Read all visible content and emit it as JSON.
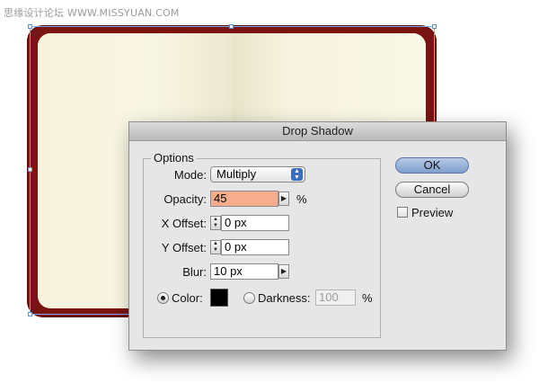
{
  "watermark": "思缘设计论坛 WWW.MISSYUAN.COM",
  "dialog": {
    "title": "Drop Shadow",
    "options_group": "Options",
    "mode_label": "Mode:",
    "mode_value": "Multiply",
    "opacity_label": "Opacity:",
    "opacity_value": "45",
    "opacity_unit": "%",
    "x_offset_label": "X Offset:",
    "x_offset_value": "0 px",
    "y_offset_label": "Y Offset:",
    "y_offset_value": "0 px",
    "blur_label": "Blur:",
    "blur_value": "10 px",
    "color_label": "Color:",
    "color_selected": true,
    "color_swatch": "#000000",
    "darkness_label": "Darkness:",
    "darkness_value": "100",
    "darkness_unit": "%",
    "ok_label": "OK",
    "cancel_label": "Cancel",
    "preview_label": "Preview",
    "preview_checked": false
  },
  "colors": {
    "notebook_cover": "#7a1410",
    "page": "#f8f6e2",
    "opacity_highlight": "#f5ad8e",
    "selection": "#7ea8e6"
  }
}
